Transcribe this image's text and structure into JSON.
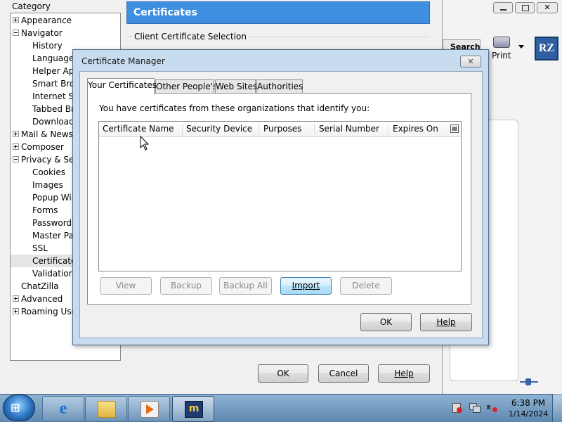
{
  "prefs": {
    "category_label": "Category",
    "tree": [
      {
        "label": "Appearance",
        "level": 0,
        "expander": "plus"
      },
      {
        "label": "Navigator",
        "level": 0,
        "expander": "minus"
      },
      {
        "label": "History",
        "level": 1
      },
      {
        "label": "Languages",
        "level": 1
      },
      {
        "label": "Helper Appl",
        "level": 1
      },
      {
        "label": "Smart Brow",
        "level": 1
      },
      {
        "label": "Internet Se",
        "level": 1
      },
      {
        "label": "Tabbed Bro",
        "level": 1
      },
      {
        "label": "Downloads",
        "level": 1
      },
      {
        "label": "Mail & Newsg",
        "level": 0,
        "expander": "plus"
      },
      {
        "label": "Composer",
        "level": 0,
        "expander": "plus"
      },
      {
        "label": "Privacy & Sec",
        "level": 0,
        "expander": "minus"
      },
      {
        "label": "Cookies",
        "level": 1
      },
      {
        "label": "Images",
        "level": 1
      },
      {
        "label": "Popup Win",
        "level": 1
      },
      {
        "label": "Forms",
        "level": 1
      },
      {
        "label": "Passwords",
        "level": 1
      },
      {
        "label": "Master Pas",
        "level": 1
      },
      {
        "label": "SSL",
        "level": 1
      },
      {
        "label": "Certificates",
        "level": 1,
        "selected": true
      },
      {
        "label": "Validation",
        "level": 1
      },
      {
        "label": "ChatZilla",
        "level": 0
      },
      {
        "label": "Advanced",
        "level": 0,
        "expander": "plus"
      },
      {
        "label": "Roaming User",
        "level": 0,
        "expander": "plus"
      }
    ],
    "panel_title": "Certificates",
    "client_selection_label": "Client Certificate Selection",
    "ok_label": "OK",
    "cancel_label": "Cancel",
    "help_label": "Help"
  },
  "browser": {
    "search_label": "Search",
    "print_label": "Print"
  },
  "dialog": {
    "title": "Certificate Manager",
    "close_symbol": "✕",
    "tabs": [
      {
        "label": "Your Certificates",
        "active": true
      },
      {
        "label": "Other People's",
        "active": false
      },
      {
        "label": "Web Sites",
        "active": false
      },
      {
        "label": "Authorities",
        "active": false
      }
    ],
    "intro_text": "You have certificates from these organizations that identify you:",
    "columns": [
      "Certificate Name",
      "Security Device",
      "Purposes",
      "Serial Number",
      "Expires On"
    ],
    "rows": [],
    "buttons": {
      "view": "View",
      "backup": "Backup",
      "backup_all": "Backup All",
      "import": "Import",
      "delete": "Delete"
    },
    "ok_label": "OK",
    "help_label": "Help"
  },
  "taskbar": {
    "time": "6:38 PM",
    "date": "1/14/2024"
  },
  "colors": {
    "accent": "#3f8fe0",
    "dialog_frame": "#c8dcef",
    "taskbar": "#6f97be"
  }
}
